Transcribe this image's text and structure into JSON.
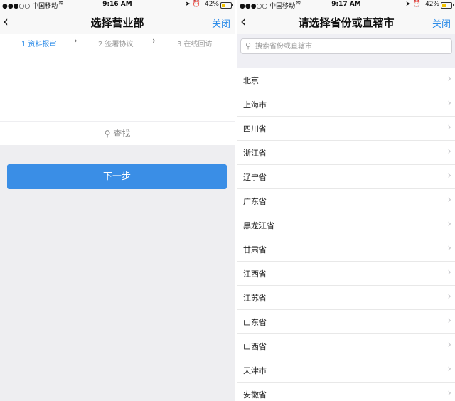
{
  "left": {
    "status": {
      "carrier": "●●●○○ 中国移动",
      "time": "9:16 AM",
      "battery": "42%",
      "battery_level": 0.42
    },
    "nav": {
      "back": "‹",
      "title": "选择营业部",
      "close": "关闭"
    },
    "steps": [
      {
        "label": "1 资料报审",
        "active": true
      },
      {
        "label": "2 签署协议",
        "active": false
      },
      {
        "label": "3 在线回访",
        "active": false
      }
    ],
    "search_label": "查找",
    "next_button": "下一步"
  },
  "right": {
    "status": {
      "carrier": "●●●○○ 中国移动",
      "time": "9:17 AM",
      "battery": "42%",
      "battery_level": 0.42
    },
    "nav": {
      "back": "‹",
      "title": "请选择省份或直辖市",
      "close": "关闭"
    },
    "search": {
      "placeholder": "搜索省份或直辖市",
      "value": ""
    },
    "provinces": [
      "北京",
      "上海市",
      "四川省",
      "浙江省",
      "辽宁省",
      "广东省",
      "黑龙江省",
      "甘肃省",
      "江西省",
      "江苏省",
      "山东省",
      "山西省",
      "天津市",
      "安徽省"
    ]
  },
  "colors": {
    "accent": "#2b8be8",
    "button": "#3a8ee6",
    "battery": "#f2c300"
  },
  "icons": {
    "back": "chevron-left-icon",
    "search": "search-icon",
    "row": "chevron-right-icon",
    "wifi": "wifi-icon",
    "location": "location-arrow-icon",
    "alarm": "alarm-icon"
  }
}
